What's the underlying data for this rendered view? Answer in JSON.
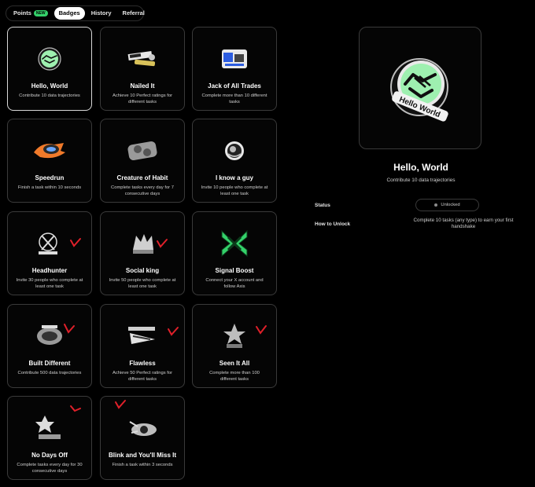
{
  "tabs": [
    {
      "label": "Points",
      "badge": "NEW"
    },
    {
      "label": "Badges"
    },
    {
      "label": "History"
    },
    {
      "label": "Referral"
    }
  ],
  "badges": [
    {
      "title": "Hello, World",
      "desc": "Contribute 10 data trajectories",
      "icon": "handshake-badge-icon",
      "earned": false
    },
    {
      "title": "Nailed It",
      "desc": "Achieve 10 Perfect ratings for different tasks",
      "icon": "nailed-it-badge-icon",
      "earned": false
    },
    {
      "title": "Jack of All Trades",
      "desc": "Complete more than 10 different tasks",
      "icon": "jack-of-all-trades-badge-icon",
      "earned": false
    },
    {
      "title": "Speedrun",
      "desc": "Finish a task within 10 seconds",
      "icon": "speedrun-badge-icon",
      "earned": false
    },
    {
      "title": "Creature of Habit",
      "desc": "Complete tasks every day for 7 consecutive days",
      "icon": "creature-of-habit-badge-icon",
      "earned": false
    },
    {
      "title": "I know a guy",
      "desc": "Invite 10 people who complete at least one task",
      "icon": "i-know-a-guy-badge-icon",
      "earned": false
    },
    {
      "title": "Headhunter",
      "desc": "Invite 30 people who complete at least one task",
      "icon": "headhunter-badge-icon",
      "earned": true
    },
    {
      "title": "Social king",
      "desc": "Invite 50 people who complete at least one task",
      "icon": "social-king-badge-icon",
      "earned": true
    },
    {
      "title": "Signal Boost",
      "desc": "Connect your X account and follow Axis",
      "icon": "x-logo-badge-icon",
      "earned": false
    },
    {
      "title": "Built Different",
      "desc": "Contribute 500 data trajectories",
      "icon": "built-different-badge-icon",
      "earned": true
    },
    {
      "title": "Flawless",
      "desc": "Achieve 50 Perfect ratings for different tasks",
      "icon": "flawless-badge-icon",
      "earned": true
    },
    {
      "title": "Seen It All",
      "desc": "Complete more than 100 different tasks",
      "icon": "seen-it-all-badge-icon",
      "earned": true
    },
    {
      "title": "No Days Off",
      "desc": "Complete tasks every day for 30 consecutive days",
      "icon": "no-days-off-badge-icon",
      "earned": true
    },
    {
      "title": "Blink and You'll Miss It",
      "desc": "Finish a task within 3 seconds",
      "icon": "blink-badge-icon",
      "earned": true
    }
  ],
  "detail": {
    "title": "Hello, World",
    "desc": "Contribute 10 data trajectories",
    "badge_text": "Hello World",
    "status_label": "Status",
    "status_value": "Unlocked",
    "unlock_label": "How to Unlock",
    "unlock_value": "Complete 10 tasks (any type) to earn your first handshake"
  },
  "colors": {
    "accent_green": "#34d16a",
    "check_red": "#e0202a"
  }
}
